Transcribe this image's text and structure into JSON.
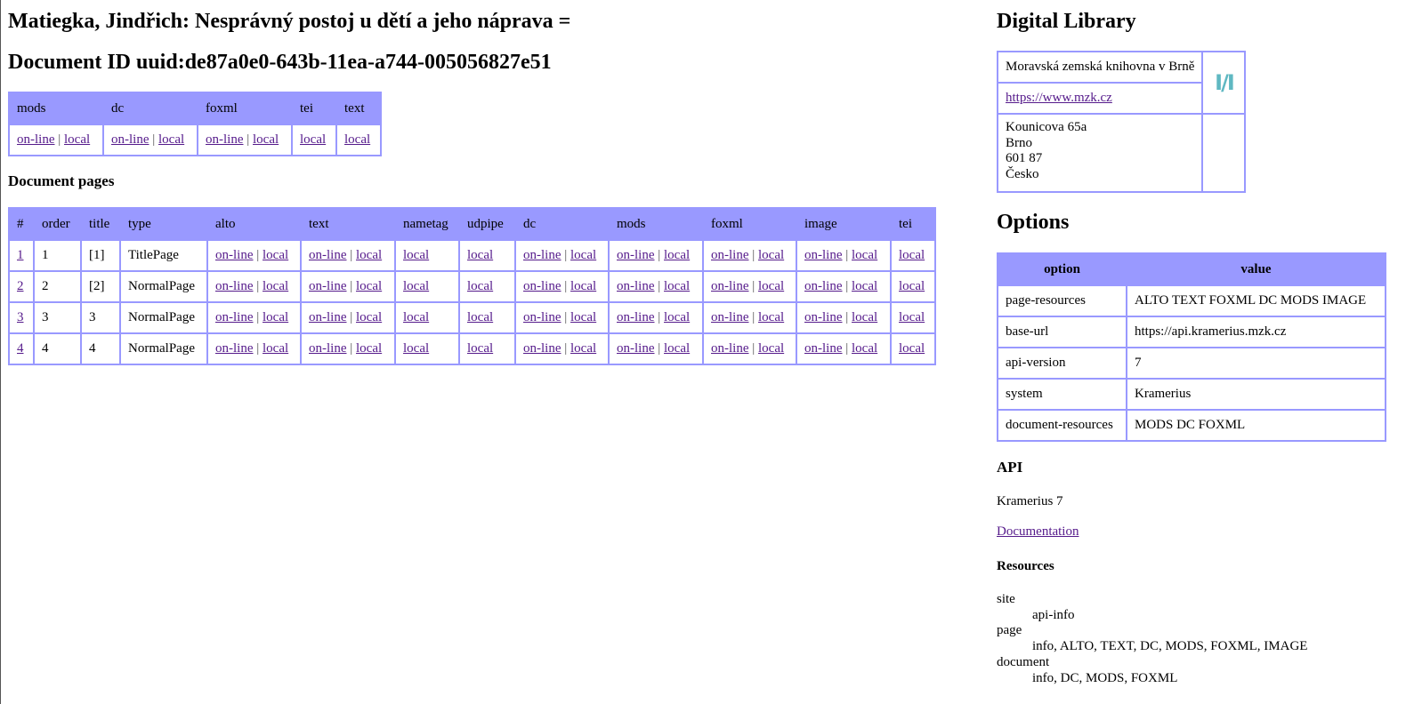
{
  "doc": {
    "title": "Matiegka, Jindřich: Nesprávný postoj u dětí a jeho náprava =",
    "id_heading": "Document ID uuid:de87a0e0-643b-11ea-a744-005056827e51"
  },
  "formats": {
    "headers": [
      "mods",
      "dc",
      "foxml",
      "tei",
      "text"
    ],
    "online_label": "on-line",
    "local_label": "local",
    "separator": "|"
  },
  "pages": {
    "heading": "Document pages",
    "headers": [
      "#",
      "order",
      "title",
      "type",
      "alto",
      "text",
      "nametag",
      "udpipe",
      "dc",
      "mods",
      "foxml",
      "image",
      "tei"
    ],
    "rows": [
      {
        "num": "1",
        "order": "1",
        "title": "[1]",
        "type": "TitlePage"
      },
      {
        "num": "2",
        "order": "2",
        "title": "[2]",
        "type": "NormalPage"
      },
      {
        "num": "3",
        "order": "3",
        "title": "3",
        "type": "NormalPage"
      },
      {
        "num": "4",
        "order": "4",
        "title": "4",
        "type": "NormalPage"
      }
    ]
  },
  "library": {
    "heading": "Digital Library",
    "name": "Moravská zemská knihovna v Brně",
    "url": "https://www.mzk.cz",
    "logo_text": "I/I",
    "address": [
      "Kounicova 65a",
      "Brno",
      "601 87",
      "Česko"
    ]
  },
  "options": {
    "heading": "Options",
    "col_option": "option",
    "col_value": "value",
    "rows": [
      {
        "option": "page-resources",
        "value": "ALTO TEXT FOXML DC MODS IMAGE"
      },
      {
        "option": "base-url",
        "value": "https://api.kramerius.mzk.cz"
      },
      {
        "option": "api-version",
        "value": "7"
      },
      {
        "option": "system",
        "value": "Kramerius"
      },
      {
        "option": "document-resources",
        "value": "MODS DC FOXML"
      }
    ]
  },
  "api": {
    "heading": "API",
    "version_text": "Kramerius 7",
    "doc_link": "Documentation",
    "resources_heading": "Resources",
    "resources": [
      {
        "term": "site",
        "desc": "api-info"
      },
      {
        "term": "page",
        "desc": "info, ALTO, TEXT, DC, MODS, FOXML, IMAGE"
      },
      {
        "term": "document",
        "desc": "info, DC, MODS, FOXML"
      }
    ]
  },
  "colors": {
    "table_border": "#9999ff",
    "header_bg": "#9999ff",
    "link": "#551a8b",
    "logo": "#5fb8c2"
  }
}
